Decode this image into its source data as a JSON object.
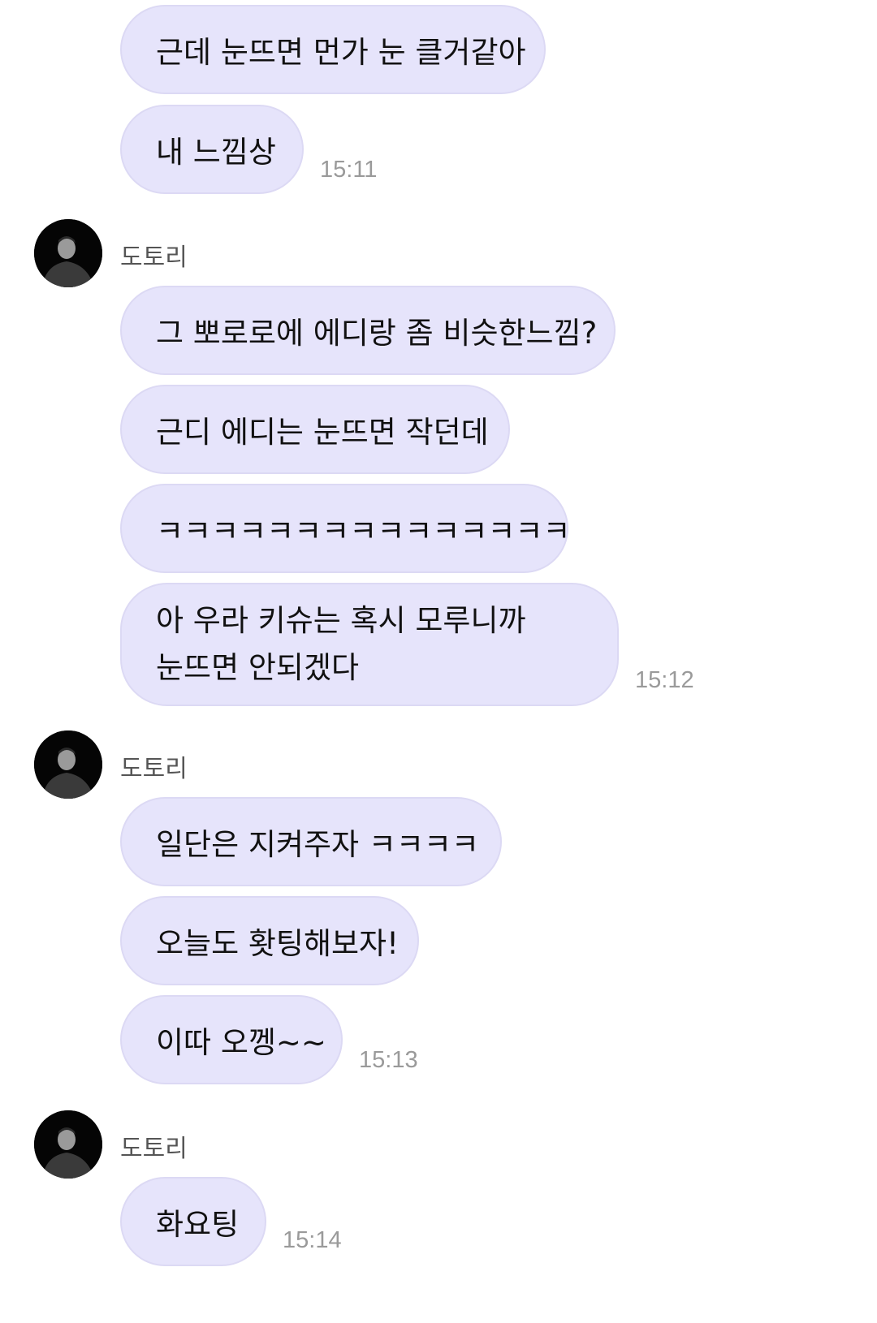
{
  "messages": {
    "m1": "근데 눈뜨면 먼가 눈 클거같아",
    "m2": "내 느낌상",
    "m3": "그 뽀로로에 에디랑 좀 비슷한느낌?",
    "m4": "근디 에디는 눈뜨면 작던데",
    "m5": "ㅋㅋㅋㅋㅋㅋㅋㅋㅋㅋㅋㅋㅋㅋㅋ",
    "m6_line1": "아 우라 키슈는 혹시 모루니까",
    "m6_line2": "눈뜨면 안되겠다",
    "m7": "일단은 지켜주자 ㅋㅋㅋㅋ",
    "m8": "오늘도 홧팅해보자!",
    "m9": "이따 오껭~~",
    "m10": "화요팅"
  },
  "times": {
    "t1": "15:11",
    "t2": "15:12",
    "t3": "15:13",
    "t4": "15:14"
  },
  "sender": {
    "name": "도토리",
    "avatar_icon": "profile-photo-icon"
  },
  "colors": {
    "bubble": "#e6e4fb",
    "timestamp": "#9a9a9a"
  }
}
